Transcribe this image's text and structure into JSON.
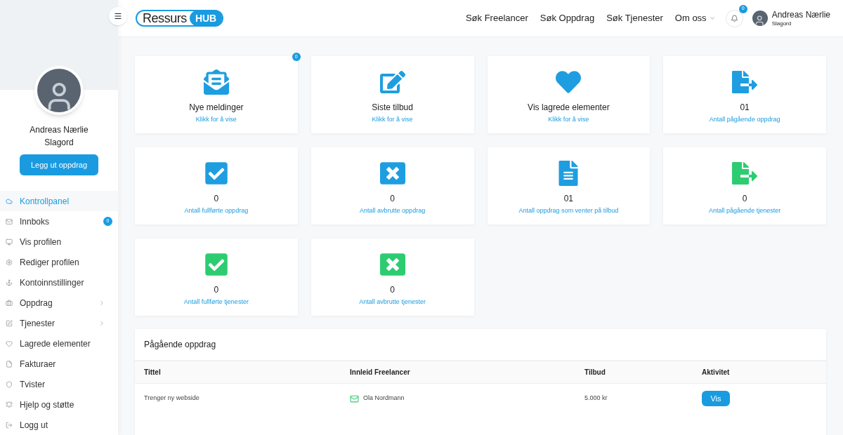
{
  "logo": {
    "word": "Ressurs",
    "badge": "HUB"
  },
  "nav": [
    {
      "label": "Søk Freelancer",
      "dropdown": false
    },
    {
      "label": "Søk Oppdrag",
      "dropdown": false
    },
    {
      "label": "Søk Tjenester",
      "dropdown": false
    },
    {
      "label": "Om oss",
      "dropdown": true
    }
  ],
  "notifications": {
    "count": "0"
  },
  "user": {
    "name": "Andreas Nærlie",
    "subtitle": "Slagord"
  },
  "profile": {
    "name": "Andreas Nærlie",
    "subtitle": "Slagord",
    "button": "Legg ut oppdrag"
  },
  "sidebar": {
    "items": [
      {
        "label": "Kontrollpanel",
        "selected": true,
        "submenu": false
      },
      {
        "label": "Innboks",
        "selected": false,
        "submenu": false,
        "badge": "0"
      },
      {
        "label": "Vis profilen",
        "selected": false,
        "submenu": false
      },
      {
        "label": "Rediger profilen",
        "selected": false,
        "submenu": false
      },
      {
        "label": "Kontoinnstillinger",
        "selected": false,
        "submenu": false
      },
      {
        "label": "Oppdrag",
        "selected": false,
        "submenu": true
      },
      {
        "label": "Tjenester",
        "selected": false,
        "submenu": true
      },
      {
        "label": "Lagrede elementer",
        "selected": false,
        "submenu": false
      },
      {
        "label": "Fakturaer",
        "selected": false,
        "submenu": false
      },
      {
        "label": "Tvister",
        "selected": false,
        "submenu": false
      },
      {
        "label": "Hjelp og støtte",
        "selected": false,
        "submenu": false
      },
      {
        "label": "Logg ut",
        "selected": false,
        "submenu": false
      }
    ]
  },
  "cards": [
    {
      "kind": "envelope",
      "color": "#1e9ee0",
      "title": "Nye meldinger",
      "link": "Klikk for å vise",
      "badge": "0"
    },
    {
      "kind": "edit",
      "color": "#1e9ee0",
      "title": "Siste tilbud",
      "link": "Klikk for å vise"
    },
    {
      "kind": "heart",
      "color": "#1e9ee0",
      "title": "Vis lagrede elementer",
      "link": "Klikk for å vise"
    },
    {
      "kind": "export",
      "color": "#1e9ee0",
      "title": "01",
      "link": "Antall pågående oppdrag"
    },
    {
      "kind": "check",
      "color": "#1e9ee0",
      "title": "0",
      "link": "Antall fullførte oppdrag"
    },
    {
      "kind": "cross",
      "color": "#1e9ee0",
      "title": "0",
      "link": "Antall avbrutte oppdrag"
    },
    {
      "kind": "document",
      "color": "#1e9ee0",
      "title": "01",
      "link": "Antall oppdrag som venter på tilbud"
    },
    {
      "kind": "export",
      "color": "#2ecc71",
      "title": "0",
      "link": "Antall pågående tjenester"
    },
    {
      "kind": "check",
      "color": "#2ecc71",
      "title": "0",
      "link": "Antall fullførte tjenester"
    },
    {
      "kind": "cross",
      "color": "#2ecc71",
      "title": "0",
      "link": "Antall avbrutte tjenester"
    }
  ],
  "table": {
    "title": "Pågående oppdrag",
    "columns": [
      "Tittel",
      "Innleid Freelancer",
      "Tilbud",
      "Aktivitet"
    ],
    "rows": [
      {
        "title": "Trenger ny webside",
        "freelancer": "Ola Nordmann",
        "offer": "5.000 kr",
        "action": "Vis"
      }
    ]
  }
}
